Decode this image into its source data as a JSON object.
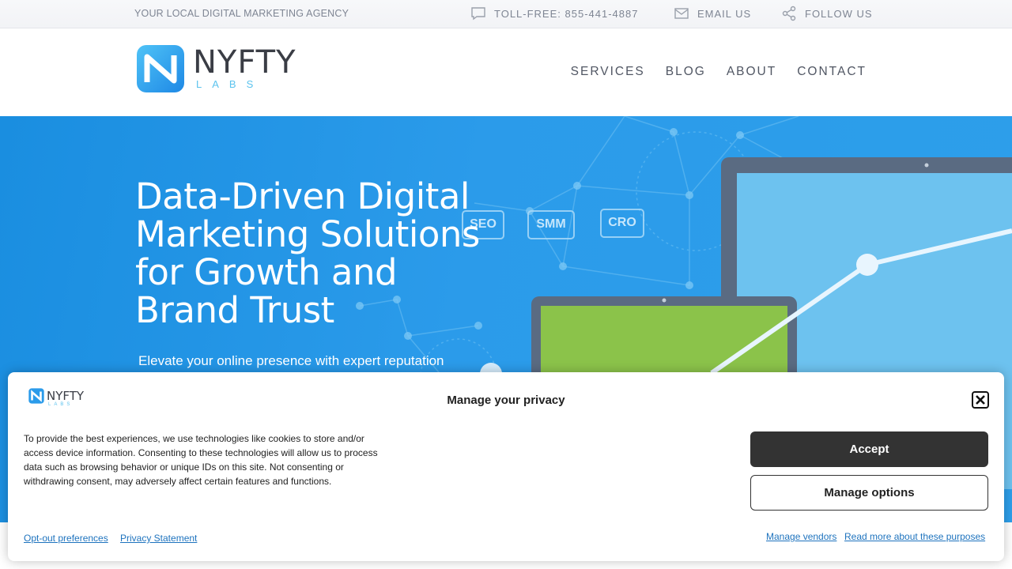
{
  "topbar": {
    "tagline": "YOUR LOCAL DIGITAL MARKETING AGENCY",
    "phone": "TOLL-FREE: 855-441-4887",
    "email": "EMAIL US",
    "follow": "FOLLOW US"
  },
  "header": {
    "logo_brand": "NYFTY",
    "logo_sub": "LABS",
    "nav": [
      "SERVICES",
      "BLOG",
      "ABOUT",
      "CONTACT"
    ]
  },
  "hero": {
    "heading": "Data-Driven Digital Marketing Solutions for Growth and Brand Trust",
    "lead": "Elevate your online presence with expert reputation",
    "tags": [
      "SEO",
      "SMM",
      "CRO"
    ]
  },
  "privacy": {
    "logo_brand": "NYFTY",
    "logo_sub": "LABS",
    "title": "Manage your privacy",
    "text": "To provide the best experiences, we use technologies like cookies to store and/or access device information. Consenting to these technologies will allow us to process data such as browsing behavior or unique IDs on this site. Not consenting or withdrawing consent, may adversely affect certain features and functions.",
    "accept": "Accept",
    "manage_options": "Manage options",
    "links": {
      "opt_out": "Opt-out preferences",
      "privacy_statement": "Privacy Statement",
      "manage_vendors": "Manage vendors",
      "read_more": "Read more about these purposes"
    }
  },
  "colors": {
    "hero_blue": "#2b9bea",
    "logo_cyan": "#5cc3ee",
    "accept_bg": "#333333",
    "link": "#1e73be"
  },
  "icons": [
    "chat-icon",
    "mail-icon",
    "share-icon",
    "close-icon"
  ]
}
